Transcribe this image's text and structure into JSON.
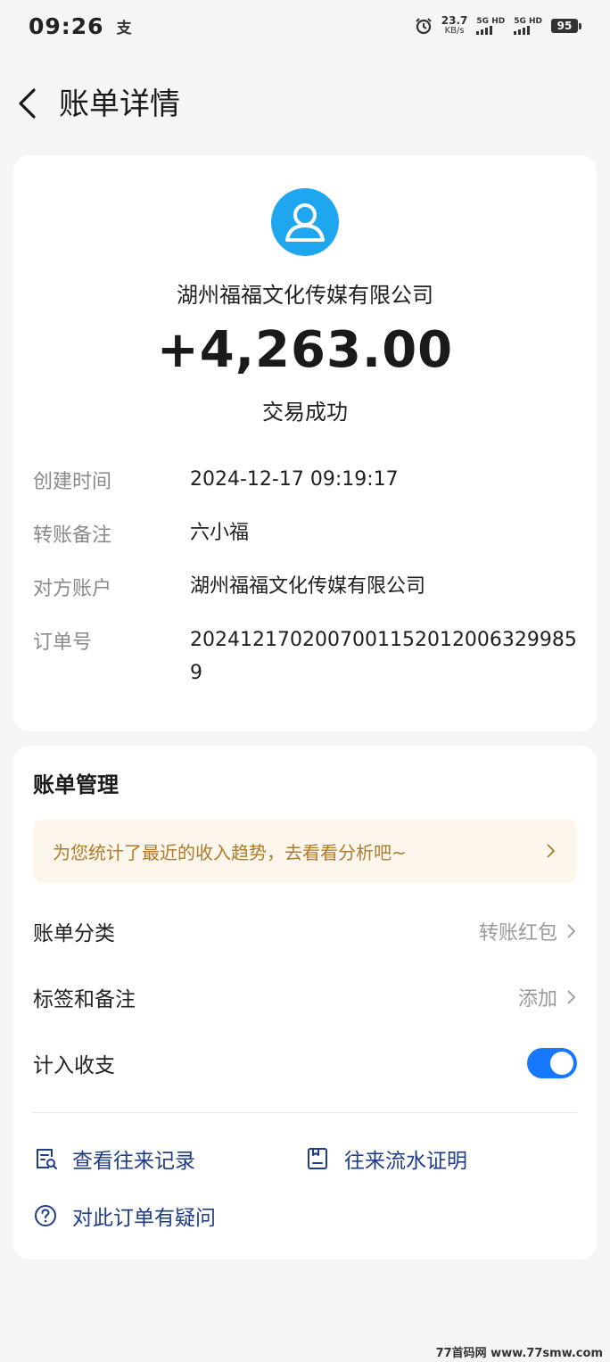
{
  "status_bar": {
    "time": "09:26",
    "app_indicator": "支",
    "net_speed_value": "23.7",
    "net_speed_unit": "KB/s",
    "sim1_label": "5G HD",
    "sim2_label": "5G HD",
    "battery": "95"
  },
  "header": {
    "title": "账单详情"
  },
  "detail": {
    "counterparty": "湖州福福文化传媒有限公司",
    "amount": "+4,263.00",
    "status": "交易成功",
    "rows": [
      {
        "label": "创建时间",
        "value": "2024-12-17 09:19:17"
      },
      {
        "label": "转账备注",
        "value": "六小福"
      },
      {
        "label": "对方账户",
        "value": "湖州福福文化传媒有限公司"
      },
      {
        "label": "订单号",
        "value": "20241217020070011520120063299859"
      }
    ]
  },
  "management": {
    "title": "账单管理",
    "banner": "为您统计了最近的收入趋势，去看看分析吧~",
    "category_label": "账单分类",
    "category_value": "转账红包",
    "tags_label": "标签和备注",
    "tags_value": "添加",
    "include_label": "计入收支",
    "include_on": true,
    "links": {
      "history": "查看往来记录",
      "proof": "往来流水证明",
      "question": "对此订单有疑问"
    }
  },
  "watermark": "77首码网 www.77smw.com",
  "colors": {
    "accent": "#1677ff",
    "avatar": "#1ea6ee",
    "banner_bg": "#fdf6ec",
    "banner_text": "#b07a2a",
    "link": "#1f3d86"
  }
}
